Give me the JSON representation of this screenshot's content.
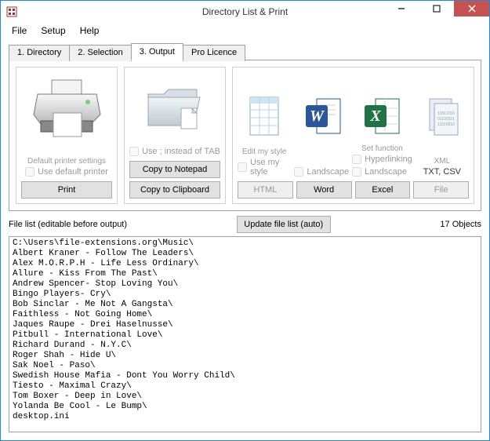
{
  "window": {
    "title": "Directory List & Print"
  },
  "menu": {
    "file": "File",
    "setup": "Setup",
    "help": "Help"
  },
  "tabs": {
    "t1": "1. Directory",
    "t2": "2. Selection",
    "t3": "3. Output",
    "t4": "Pro Licence"
  },
  "panel": {
    "print": {
      "default_label": "Default printer settings",
      "use_default": "Use default printer",
      "btn": "Print"
    },
    "copy": {
      "use_semi": "Use ; instead of TAB",
      "notepad": "Copy to Notepad",
      "clipboard": "Copy to Clipboard"
    },
    "opts": {
      "edit_style": "Edit my style",
      "use_style": "Use my style",
      "landscape": "Landscape",
      "landscape2": "Landscape",
      "setfunc": "Set function",
      "hyperlinking": "Hyperlinking",
      "xml": "XML",
      "txtcsv": "TXT, CSV",
      "html": "HTML",
      "word": "Word",
      "excel": "Excel",
      "file": "File"
    }
  },
  "filelist": {
    "label": "File list (editable before output)",
    "update_btn": "Update file list (auto)",
    "count": "17 Objects",
    "lines": [
      "C:\\Users\\file-extensions.org\\Music\\",
      "Albert Kraner - Follow The Leaders\\",
      "Alex M.O.R.P.H - Life Less Ordinary\\",
      "Allure - Kiss From The Past\\",
      "Andrew Spencer- Stop Loving You\\",
      "Bingo Players- Cry\\",
      "Bob Sinclar - Me Not A Gangsta\\",
      "Faithless - Not Going Home\\",
      "Jaques Raupe - Drei Haselnusse\\",
      "Pitbull - International Love\\",
      "Richard Durand - N.Y.C\\",
      "Roger Shah - Hide U\\",
      "Sak Noel - Paso\\",
      "Swedish House Mafia - Dont You Worry Child\\",
      "Tiesto - Maximal Crazy\\",
      "Tom Boxer - Deep in Love\\",
      "Yolanda Be Cool - Le Bump\\",
      "desktop.ini"
    ]
  }
}
